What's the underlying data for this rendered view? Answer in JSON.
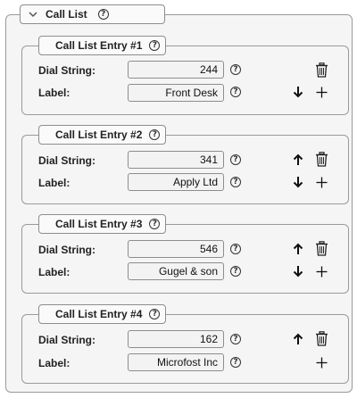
{
  "call_list": {
    "title": "Call List",
    "dial_string_label": "Dial String:",
    "label_label": "Label:",
    "entries": [
      {
        "title": "Call List Entry #1",
        "dial_string": "244",
        "label": "Front Desk"
      },
      {
        "title": "Call List Entry #2",
        "dial_string": "341",
        "label": "Apply Ltd"
      },
      {
        "title": "Call List Entry #3",
        "dial_string": "546",
        "label": "Gugel & son"
      },
      {
        "title": "Call List Entry #4",
        "dial_string": "162",
        "label": "Microfost Inc"
      }
    ]
  },
  "icons": {
    "help": "help-circle-icon",
    "delete": "trash-icon",
    "move_up": "arrow-up-icon",
    "move_down": "arrow-down-icon",
    "add": "plus-icon",
    "collapse": "chevron-down-icon"
  }
}
